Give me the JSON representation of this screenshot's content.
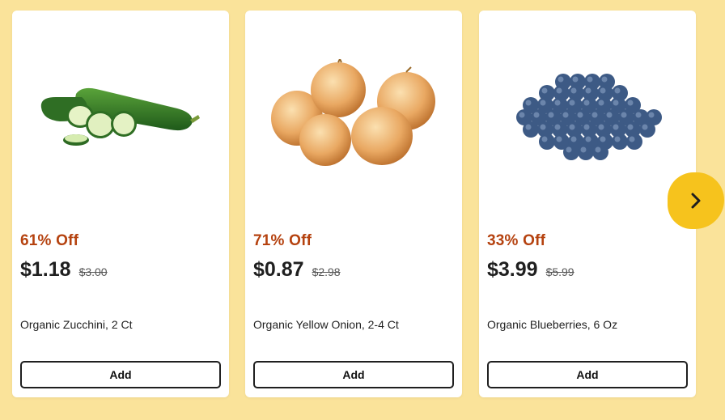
{
  "products": [
    {
      "discount": "61% Off",
      "price": "$1.18",
      "old_price": "$3.00",
      "name": "Organic Zucchini, 2 Ct",
      "image_icon": "zucchini-image",
      "add_label": "Add"
    },
    {
      "discount": "71% Off",
      "price": "$0.87",
      "old_price": "$2.98",
      "name": "Organic Yellow Onion, 2-4 Ct",
      "image_icon": "yellow-onion-image",
      "add_label": "Add"
    },
    {
      "discount": "33% Off",
      "price": "$3.99",
      "old_price": "$5.99",
      "name": "Organic Blueberries, 6 Oz",
      "image_icon": "blueberries-image",
      "add_label": "Add"
    }
  ],
  "carousel": {
    "next_icon": "chevron-right-icon"
  },
  "colors": {
    "background": "#fae39a",
    "discount": "#b5420f",
    "accent": "#f6c31d"
  }
}
